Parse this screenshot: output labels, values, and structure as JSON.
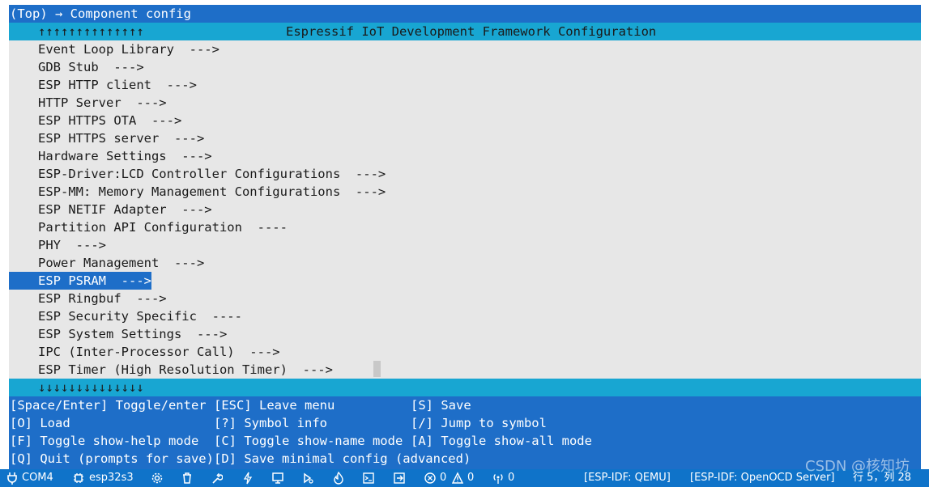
{
  "header": {
    "breadcrumb": "(Top) → Component config"
  },
  "title_bar": {
    "scroll_up": "↑↑↑↑↑↑↑↑↑↑↑↑↑↑",
    "title": "Espressif IoT Development Framework Configuration"
  },
  "menu": {
    "items": [
      {
        "label": "Event Loop Library  --->",
        "selected": false
      },
      {
        "label": "GDB Stub  --->",
        "selected": false
      },
      {
        "label": "ESP HTTP client  --->",
        "selected": false
      },
      {
        "label": "HTTP Server  --->",
        "selected": false
      },
      {
        "label": "ESP HTTPS OTA  --->",
        "selected": false
      },
      {
        "label": "ESP HTTPS server  --->",
        "selected": false
      },
      {
        "label": "Hardware Settings  --->",
        "selected": false
      },
      {
        "label": "ESP-Driver:LCD Controller Configurations  --->",
        "selected": false
      },
      {
        "label": "ESP-MM: Memory Management Configurations  --->",
        "selected": false
      },
      {
        "label": "ESP NETIF Adapter  --->",
        "selected": false
      },
      {
        "label": "Partition API Configuration  ----",
        "selected": false
      },
      {
        "label": "PHY  --->",
        "selected": false
      },
      {
        "label": "Power Management  --->",
        "selected": false
      },
      {
        "label": "ESP PSRAM  --->",
        "selected": true
      },
      {
        "label": "ESP Ringbuf  --->",
        "selected": false
      },
      {
        "label": "ESP Security Specific  ----",
        "selected": false
      },
      {
        "label": "ESP System Settings  --->",
        "selected": false
      },
      {
        "label": "IPC (Inter-Processor Call)  --->",
        "selected": false
      },
      {
        "label": "ESP Timer (High Resolution Timer)  --->",
        "selected": false
      }
    ]
  },
  "bottom_bar": {
    "scroll_down": "↓↓↓↓↓↓↓↓↓↓↓↓↓↓"
  },
  "keys": {
    "rows": [
      [
        "[Space/Enter] Toggle/enter",
        "[ESC] Leave menu",
        "[S] Save"
      ],
      [
        "[O] Load",
        "[?] Symbol info",
        "[/] Jump to symbol"
      ],
      [
        "[F] Toggle show-help mode",
        "[C] Toggle show-name mode",
        "[A] Toggle show-all mode"
      ],
      [
        "[Q] Quit (prompts for save)",
        "[D] Save minimal config (advanced)",
        ""
      ]
    ]
  },
  "status_bar": {
    "port": "COM4",
    "target": "esp32s3",
    "errors": "0",
    "warnings": "0",
    "broadcast": "0",
    "qemu": "[ESP-IDF: QEMU]",
    "openocd": "[ESP-IDF: OpenOCD Server]",
    "position": "行 5，列 28",
    "watermark": "CSDN @核知坊",
    "icons": [
      "plug-icon",
      "chip-icon",
      "gear-icon",
      "trash-icon",
      "wrench-icon",
      "bolt-icon",
      "monitor-icon",
      "build-monitor-icon",
      "flame-icon",
      "terminal-icon",
      "arrow-box-icon",
      "error-circle-icon",
      "warning-triangle-icon",
      "broadcast-icon"
    ]
  },
  "colors": {
    "top": "#1e6ec8",
    "title": "#18a6d2",
    "menu_bg": "#e7e7e7",
    "selected": "#1e6ec8",
    "status": "#0f73c9"
  }
}
